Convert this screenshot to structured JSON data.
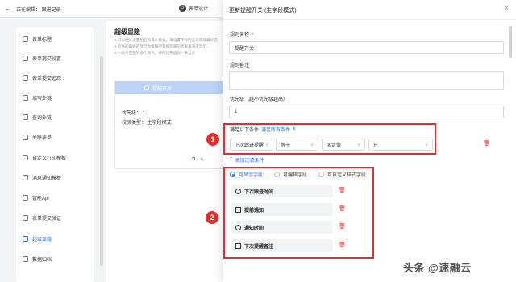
{
  "topbar": {
    "back_icon": "left-arrow-icon",
    "crumb": "正在编辑：  跟进记录",
    "step_num": "3",
    "step_label": "表单设计"
  },
  "sidebar": {
    "items": [
      {
        "label": "表单标题",
        "icon": "form-icon",
        "active": false
      },
      {
        "label": "表单提交设置",
        "icon": "settings-icon",
        "active": false
      },
      {
        "label": "表单提交追踪",
        "icon": "eye-icon",
        "active": false
      },
      {
        "label": "填写外链",
        "icon": "link-icon",
        "active": false
      },
      {
        "label": "查询外链",
        "icon": "link-icon",
        "active": false
      },
      {
        "label": "关联表单",
        "icon": "relation-icon",
        "active": false
      },
      {
        "label": "自定义打印模板",
        "icon": "print-icon",
        "active": false
      },
      {
        "label": "消息通知模板",
        "icon": "message-icon",
        "active": false
      },
      {
        "label": "智能Api",
        "icon": "api-icon",
        "active": false
      },
      {
        "label": "表单提交验证",
        "icon": "check-icon",
        "active": false
      },
      {
        "label": "超级显隐",
        "icon": "toggle-icon",
        "active": true
      },
      {
        "label": "数据归档",
        "icon": "archive-icon",
        "active": false
      }
    ]
  },
  "main": {
    "title": "超级显隐",
    "desc": [
      "1.可以通过设置相应的设计模式，来设置字段的显示或隐藏状态",
      "2.控件的最终的显示会根据所有规则来的结果来决定显示，",
      "3.一组件匹配到多个颜色，按照优先级高一来显示"
    ],
    "card": {
      "head": "提醒开关",
      "priority": "优先级：  1",
      "type": "校验类型：  主字段模式"
    }
  },
  "drawer": {
    "title": "更新提醒开关 (主字段模式)",
    "rule_name_label": "规则名称",
    "rule_name_value": "提醒开关",
    "rule_note_label": "规则备注",
    "priority_label": "优先级（越小优先级越高）",
    "priority_value": "1",
    "condition": {
      "prefix": "满足以下条件",
      "link": "满足所有条件",
      "field": "下次跟进提醒",
      "operator": "等于",
      "value_type": "固定值",
      "value": "开"
    },
    "add_filter": "添加过滤条件",
    "field_modes": [
      {
        "label": "可显示字段",
        "on": true
      },
      {
        "label": "可编辑字段",
        "on": false
      },
      {
        "label": "可自定义样式字段",
        "on": false
      }
    ],
    "fields": [
      {
        "label": "下次跟进时间",
        "icon": "clock-icon"
      },
      {
        "label": "提前通知",
        "icon": "calendar-icon"
      },
      {
        "label": "通知时间",
        "icon": "clock-icon"
      },
      {
        "label": "下次提醒备注",
        "icon": "note-icon"
      }
    ]
  },
  "annotations": {
    "badge1": "1",
    "badge2": "2"
  },
  "watermark": "头条 @速融云",
  "colors": {
    "accent": "#2d6ae3",
    "danger": "#e02d2d",
    "card_head": "#bcd3f7"
  }
}
